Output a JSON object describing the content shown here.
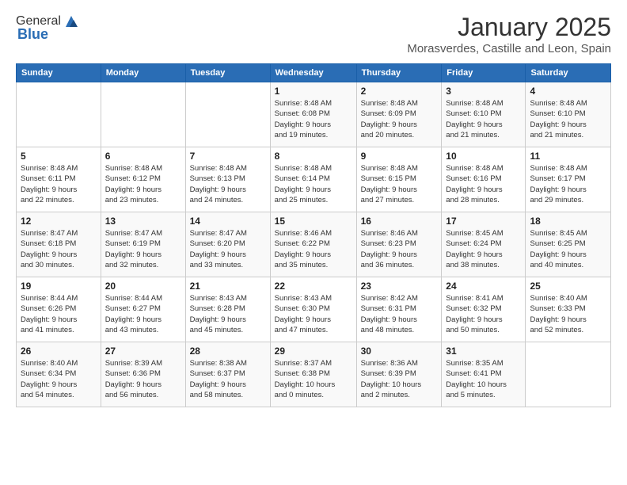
{
  "logo": {
    "general": "General",
    "blue": "Blue"
  },
  "title": "January 2025",
  "location": "Morasverdes, Castille and Leon, Spain",
  "days_header": [
    "Sunday",
    "Monday",
    "Tuesday",
    "Wednesday",
    "Thursday",
    "Friday",
    "Saturday"
  ],
  "weeks": [
    [
      {
        "day": "",
        "info": ""
      },
      {
        "day": "",
        "info": ""
      },
      {
        "day": "",
        "info": ""
      },
      {
        "day": "1",
        "info": "Sunrise: 8:48 AM\nSunset: 6:08 PM\nDaylight: 9 hours\nand 19 minutes."
      },
      {
        "day": "2",
        "info": "Sunrise: 8:48 AM\nSunset: 6:09 PM\nDaylight: 9 hours\nand 20 minutes."
      },
      {
        "day": "3",
        "info": "Sunrise: 8:48 AM\nSunset: 6:10 PM\nDaylight: 9 hours\nand 21 minutes."
      },
      {
        "day": "4",
        "info": "Sunrise: 8:48 AM\nSunset: 6:10 PM\nDaylight: 9 hours\nand 21 minutes."
      }
    ],
    [
      {
        "day": "5",
        "info": "Sunrise: 8:48 AM\nSunset: 6:11 PM\nDaylight: 9 hours\nand 22 minutes."
      },
      {
        "day": "6",
        "info": "Sunrise: 8:48 AM\nSunset: 6:12 PM\nDaylight: 9 hours\nand 23 minutes."
      },
      {
        "day": "7",
        "info": "Sunrise: 8:48 AM\nSunset: 6:13 PM\nDaylight: 9 hours\nand 24 minutes."
      },
      {
        "day": "8",
        "info": "Sunrise: 8:48 AM\nSunset: 6:14 PM\nDaylight: 9 hours\nand 25 minutes."
      },
      {
        "day": "9",
        "info": "Sunrise: 8:48 AM\nSunset: 6:15 PM\nDaylight: 9 hours\nand 27 minutes."
      },
      {
        "day": "10",
        "info": "Sunrise: 8:48 AM\nSunset: 6:16 PM\nDaylight: 9 hours\nand 28 minutes."
      },
      {
        "day": "11",
        "info": "Sunrise: 8:48 AM\nSunset: 6:17 PM\nDaylight: 9 hours\nand 29 minutes."
      }
    ],
    [
      {
        "day": "12",
        "info": "Sunrise: 8:47 AM\nSunset: 6:18 PM\nDaylight: 9 hours\nand 30 minutes."
      },
      {
        "day": "13",
        "info": "Sunrise: 8:47 AM\nSunset: 6:19 PM\nDaylight: 9 hours\nand 32 minutes."
      },
      {
        "day": "14",
        "info": "Sunrise: 8:47 AM\nSunset: 6:20 PM\nDaylight: 9 hours\nand 33 minutes."
      },
      {
        "day": "15",
        "info": "Sunrise: 8:46 AM\nSunset: 6:22 PM\nDaylight: 9 hours\nand 35 minutes."
      },
      {
        "day": "16",
        "info": "Sunrise: 8:46 AM\nSunset: 6:23 PM\nDaylight: 9 hours\nand 36 minutes."
      },
      {
        "day": "17",
        "info": "Sunrise: 8:45 AM\nSunset: 6:24 PM\nDaylight: 9 hours\nand 38 minutes."
      },
      {
        "day": "18",
        "info": "Sunrise: 8:45 AM\nSunset: 6:25 PM\nDaylight: 9 hours\nand 40 minutes."
      }
    ],
    [
      {
        "day": "19",
        "info": "Sunrise: 8:44 AM\nSunset: 6:26 PM\nDaylight: 9 hours\nand 41 minutes."
      },
      {
        "day": "20",
        "info": "Sunrise: 8:44 AM\nSunset: 6:27 PM\nDaylight: 9 hours\nand 43 minutes."
      },
      {
        "day": "21",
        "info": "Sunrise: 8:43 AM\nSunset: 6:28 PM\nDaylight: 9 hours\nand 45 minutes."
      },
      {
        "day": "22",
        "info": "Sunrise: 8:43 AM\nSunset: 6:30 PM\nDaylight: 9 hours\nand 47 minutes."
      },
      {
        "day": "23",
        "info": "Sunrise: 8:42 AM\nSunset: 6:31 PM\nDaylight: 9 hours\nand 48 minutes."
      },
      {
        "day": "24",
        "info": "Sunrise: 8:41 AM\nSunset: 6:32 PM\nDaylight: 9 hours\nand 50 minutes."
      },
      {
        "day": "25",
        "info": "Sunrise: 8:40 AM\nSunset: 6:33 PM\nDaylight: 9 hours\nand 52 minutes."
      }
    ],
    [
      {
        "day": "26",
        "info": "Sunrise: 8:40 AM\nSunset: 6:34 PM\nDaylight: 9 hours\nand 54 minutes."
      },
      {
        "day": "27",
        "info": "Sunrise: 8:39 AM\nSunset: 6:36 PM\nDaylight: 9 hours\nand 56 minutes."
      },
      {
        "day": "28",
        "info": "Sunrise: 8:38 AM\nSunset: 6:37 PM\nDaylight: 9 hours\nand 58 minutes."
      },
      {
        "day": "29",
        "info": "Sunrise: 8:37 AM\nSunset: 6:38 PM\nDaylight: 10 hours\nand 0 minutes."
      },
      {
        "day": "30",
        "info": "Sunrise: 8:36 AM\nSunset: 6:39 PM\nDaylight: 10 hours\nand 2 minutes."
      },
      {
        "day": "31",
        "info": "Sunrise: 8:35 AM\nSunset: 6:41 PM\nDaylight: 10 hours\nand 5 minutes."
      },
      {
        "day": "",
        "info": ""
      }
    ]
  ]
}
